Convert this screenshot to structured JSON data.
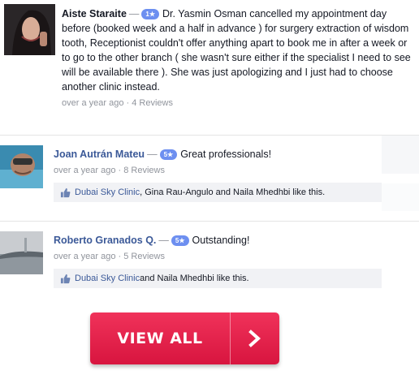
{
  "reviews": [
    {
      "author": "Aiste Staraite",
      "rating": "1★",
      "text": "Dr. Yasmin Osman cancelled my appointment day before (booked week and a half in advance ) for surgery extraction of wisdom tooth, Receptionist couldn't offer anything apart to book me in after a week or to go to the other branch ( she wasn't sure either if the specialist I need to see will be available there ). She was just apologizing and I just had to choose another clinic instead.",
      "meta": "over a year ago · 4 Reviews"
    },
    {
      "author": "Joan Autrán Mateu",
      "rating": "5★",
      "text": "Great professionals!",
      "meta": "over a year ago · 8 Reviews",
      "likes_page": "Dubai Sky Clinic",
      "likes_rest": ", Gina Rau-Angulo and Naila Mhedhbi like this."
    },
    {
      "author": "Roberto Granados Q.",
      "rating": "5★",
      "text": "Outstanding!",
      "meta": "over a year ago · 5 Reviews",
      "likes_page": "Dubai Sky Clinic",
      "likes_rest": " and Naila Mhedhbi like this."
    }
  ],
  "separator": "—",
  "button": {
    "label": "VIEW ALL",
    "icon": "chevron-right-icon",
    "color": "#e8244e"
  },
  "colors": {
    "link": "#3b5998",
    "badge": "#6d8ff0",
    "meta": "#90949c"
  }
}
